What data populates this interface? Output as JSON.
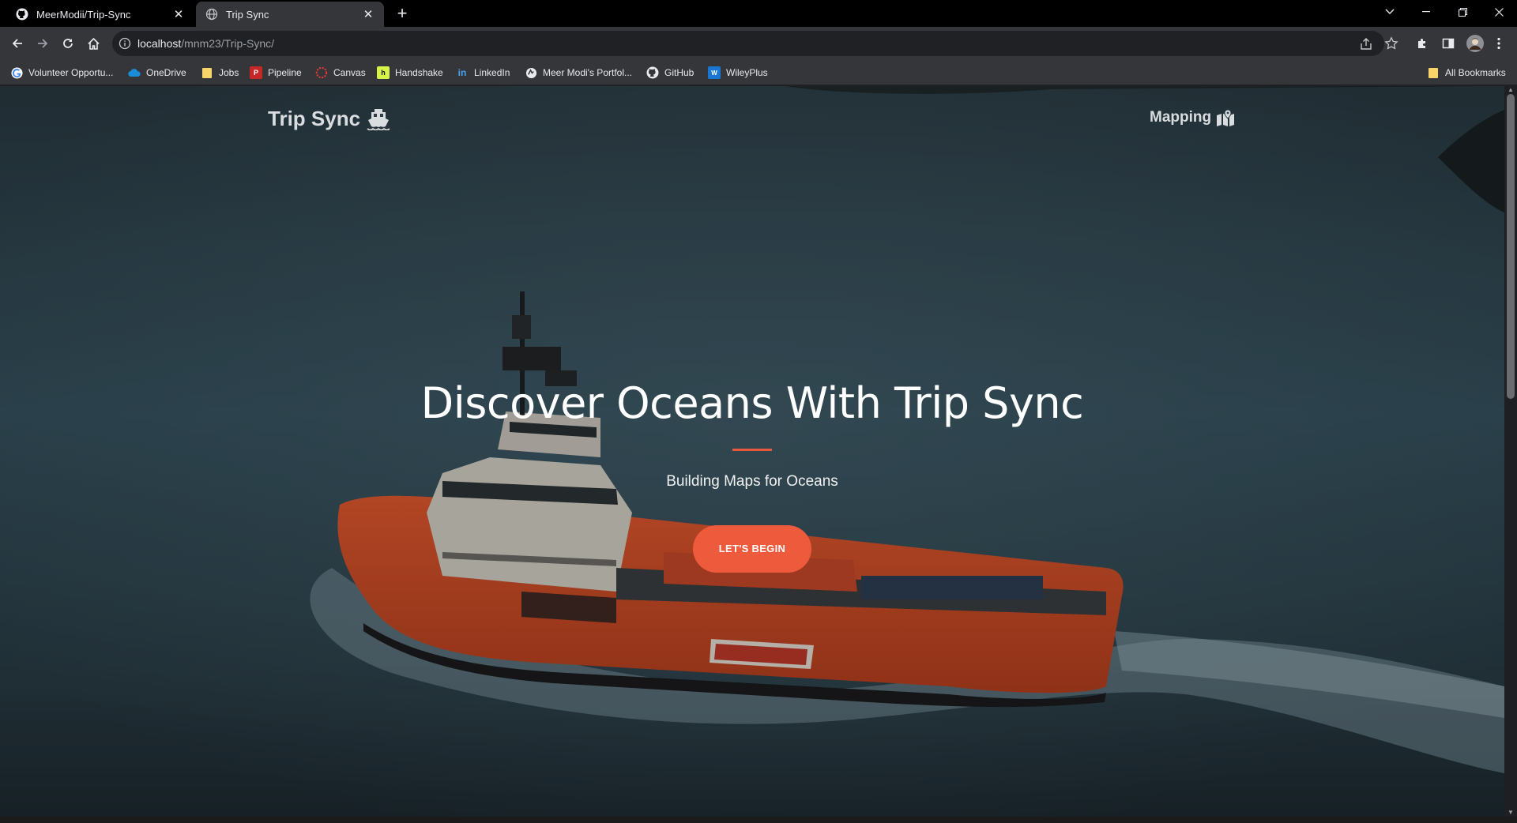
{
  "browser": {
    "tabs": [
      {
        "title": "MeerModii/Trip-Sync",
        "favicon": "github-icon",
        "active": false
      },
      {
        "title": "Trip Sync",
        "favicon": "globe-icon",
        "active": true
      }
    ],
    "new_tab_label": "+",
    "address": {
      "host": "localhost",
      "path": "/mnm23/Trip-Sync/"
    },
    "bookmarks": [
      {
        "label": "Volunteer Opportu...",
        "icon": "google-icon",
        "color": "#ffffff"
      },
      {
        "label": "OneDrive",
        "icon": "onedrive-icon",
        "color": "#1a8cd8"
      },
      {
        "label": "Jobs",
        "icon": "folder-icon",
        "color": "#f9d46b"
      },
      {
        "label": "Pipeline",
        "icon": "pipeline-icon",
        "color": "#c62828"
      },
      {
        "label": "Canvas",
        "icon": "canvas-icon",
        "color": "#d32f2f"
      },
      {
        "label": "Handshake",
        "icon": "handshake-icon",
        "color": "#d7f34a"
      },
      {
        "label": "LinkedIn",
        "icon": "linkedin-icon",
        "color": "#0a66c2"
      },
      {
        "label": "Meer Modi's Portfol...",
        "icon": "portfolio-icon",
        "color": "#e8eaed"
      },
      {
        "label": "GitHub",
        "icon": "github-icon",
        "color": "#e8eaed"
      },
      {
        "label": "WileyPlus",
        "icon": "wileyplus-icon",
        "color": "#1976d2"
      }
    ],
    "all_bookmarks_label": "All Bookmarks"
  },
  "site": {
    "brand": "Trip Sync",
    "nav_link": "Mapping",
    "hero_title": "Discover Oceans With Trip Sync",
    "hero_subtitle": "Building Maps for Oceans",
    "cta_label": "LET'S BEGIN",
    "colors": {
      "accent": "#ee5a3c",
      "ocean": "#2e3f48",
      "hull": "#d9482a"
    }
  }
}
